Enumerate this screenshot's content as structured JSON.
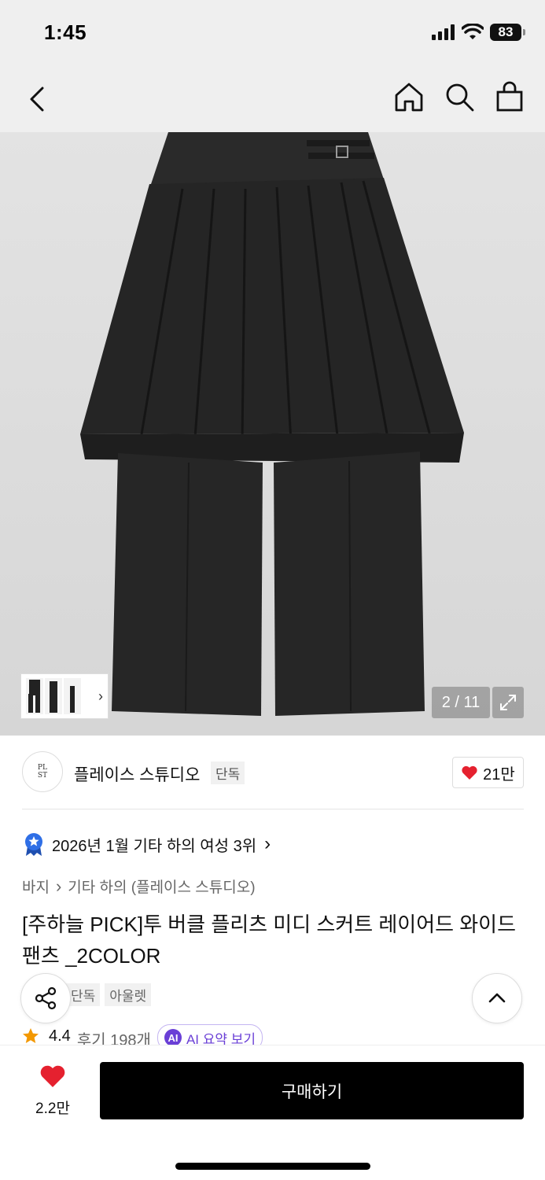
{
  "status_bar": {
    "time": "1:45",
    "battery": "83",
    "icons": [
      "signal-icon",
      "wifi-icon",
      "battery-icon"
    ]
  },
  "nav": {
    "icons": [
      "back-icon",
      "home-icon",
      "search-icon",
      "bag-icon"
    ]
  },
  "gallery": {
    "counter": "2 / 11",
    "current": 2,
    "total": 11,
    "thumb_more": "›"
  },
  "brand": {
    "logo_text": "PLACE STUDIO",
    "name": "플레이스 스튜디오",
    "tag": "단독",
    "likes": "21만"
  },
  "ranking": {
    "text": "2026년 1월 기타 하의 여성 3위",
    "chevron": "›"
  },
  "breadcrumb": {
    "items": [
      "바지",
      "기타 하의 (플레이스 스튜디오)"
    ],
    "separator": "›"
  },
  "product": {
    "title": "[주하늘 PICK]투 버클 플리츠 미디 스커트 레이어드 와이드 팬츠 _2COLOR",
    "tags": [
      "단독",
      "아울렛"
    ]
  },
  "rating": {
    "value": "4.4",
    "review_label": "후기 198개",
    "ai_badge": "AI",
    "ai_label": "AI 요약 보기"
  },
  "bottom": {
    "like_count": "2.2만",
    "buy_label": "구매하기"
  },
  "colors": {
    "accent_purple": "#6a3fd6",
    "heart_red": "#e5212f",
    "rank_badge_blue": "#2f6fe6",
    "star_orange": "#f39800"
  }
}
